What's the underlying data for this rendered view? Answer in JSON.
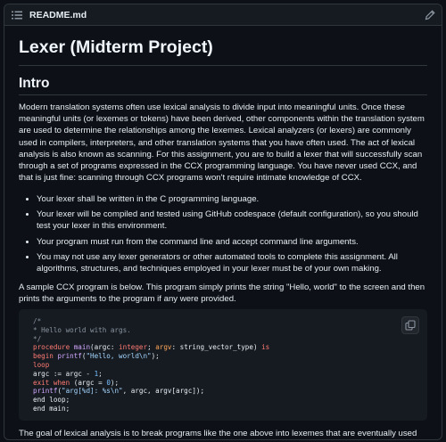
{
  "file_header": {
    "icon": "list-icon",
    "filename": "README.md",
    "edit_icon": "pencil-icon"
  },
  "doc": {
    "title": "Lexer (Midterm Project)",
    "section_heading": "Intro",
    "intro_paragraph": "Modern translation systems often use lexical analysis to divide input into meaningful units. Once these meaningful units (or lexemes or tokens) have been derived, other components within the translation system are used to determine the relationships among the lexemes. Lexical analyzers (or lexers) are commonly used in compilers, interpreters, and other translation systems that you have often used. The act of lexical analysis is also known as scanning. For this assignment, you are to build a lexer that will successfully scan through a set of programs expressed in the CCX programming language. You have never used CCX, and that is just fine: scanning through CCX programs won't require intimate knowledge of CCX.",
    "requirements": [
      "Your lexer shall be written in the C programming language.",
      "Your lexer will be compiled and tested using GitHub codespace (default configuration), so you should test your lexer in this environment.",
      "Your program must run from the command line and accept command line arguments.",
      "You may not use any lexer generators or other automated tools to complete this assignment. All algorithms, structures, and techniques employed in your lexer must be of your own making."
    ],
    "sample_paragraph": "A sample CCX program is below. This program simply prints the string \"Hello, world\" to the screen and then prints the arguments to the program if any were provided.",
    "code": {
      "copy_icon": "copy-icon",
      "lines": {
        "l1": "/*",
        "l2": "* Hello world with args.",
        "l3": "*/",
        "l4_kw": "procedure",
        "l4_fn": "main",
        "l4_a": "(argc: ",
        "l4_ty1": "integer",
        "l4_b": "; ",
        "l4_argv": "argv",
        "l4_c": ": string_vector_type) ",
        "l4_is": "is",
        "l5_kw": "begin",
        "l5_fn": "printf",
        "l5_a": "(",
        "l5_str": "\"Hello, world\\n\"",
        "l5_b": ");",
        "l6_kw": "loop",
        "l7_a": "argc := argc - ",
        "l7_num": "1",
        "l7_b": ";",
        "l8_kw1": "exit",
        "l8_kw2": "when",
        "l8_a": " (argc = ",
        "l8_num": "0",
        "l8_b": ");",
        "l9_fn": "printf",
        "l9_a": "(",
        "l9_str": "\"arg[%d]: %s\\n\"",
        "l9_b": ", argc, argv[argc]);",
        "l10_kw": "end loop",
        "l10_b": ";",
        "l11_kw": "end",
        "l11_b": " main;"
      }
    },
    "closing_paragraph": "The goal of lexical analysis is to break programs like the one above into lexemes that are eventually used by"
  },
  "colors": {
    "background": "#0d1117",
    "header": "#161b22",
    "border": "#30363d",
    "text": "#e6edf3"
  }
}
